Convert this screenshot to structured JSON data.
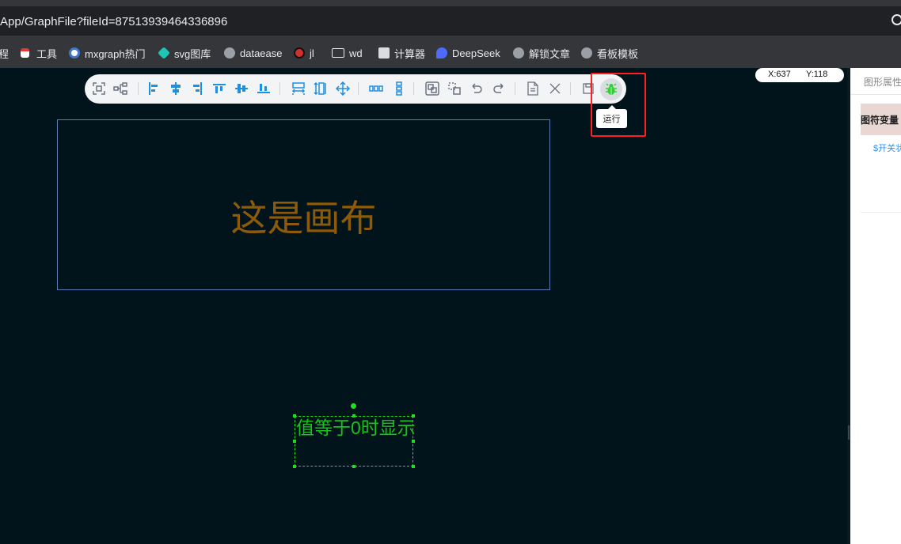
{
  "browser": {
    "url": "App/GraphFile?fileId=87513939464336896",
    "bookmarks": [
      {
        "label": "程",
        "icon": "none"
      },
      {
        "label": "工具",
        "icon": "calendar-icon"
      },
      {
        "label": "mxgraph热门",
        "icon": "mxgraph-icon"
      },
      {
        "label": "svg图库",
        "icon": "svg-icon"
      },
      {
        "label": "dataease",
        "icon": "globe-icon"
      },
      {
        "label": "jl",
        "icon": "ladybug-icon"
      },
      {
        "label": "wd",
        "icon": "folder-icon"
      },
      {
        "label": "计算器",
        "icon": "calculator-icon"
      },
      {
        "label": "DeepSeek",
        "icon": "deepseek-icon"
      },
      {
        "label": "解锁文章",
        "icon": "globe-icon"
      },
      {
        "label": "看板模板",
        "icon": "globe-icon"
      }
    ]
  },
  "toolbar": {
    "buttons": [
      "fit-icon",
      "tree-icon",
      "align-left-icon",
      "align-center-icon",
      "align-right-icon",
      "align-top-icon",
      "align-middle-icon",
      "align-bottom-icon",
      "same-width-icon",
      "same-height-icon",
      "move-icon",
      "distribute-horizontal-icon",
      "distribute-vertical-icon",
      "group-icon",
      "ungroup-icon",
      "undo-icon",
      "redo-icon",
      "export-icon",
      "close-icon",
      "save-icon"
    ],
    "run_tooltip": "运行",
    "run_icon": "bug-icon"
  },
  "coords": {
    "x": "X:637",
    "y": "Y:118"
  },
  "canvas": {
    "rect_label": "这是画布",
    "selected_text": "值等于0时显示"
  },
  "panel": {
    "tab": "图形属性",
    "header": "图符变量",
    "link": "$开关状"
  },
  "colors": {
    "canvas_bg": "#02141b",
    "rect_border": "#5c7cb6",
    "rect_text": "#8c5a08",
    "selection": "#1fe01f",
    "highlight": "#ff1f1f",
    "icon_blue": "#1f8fe0"
  }
}
